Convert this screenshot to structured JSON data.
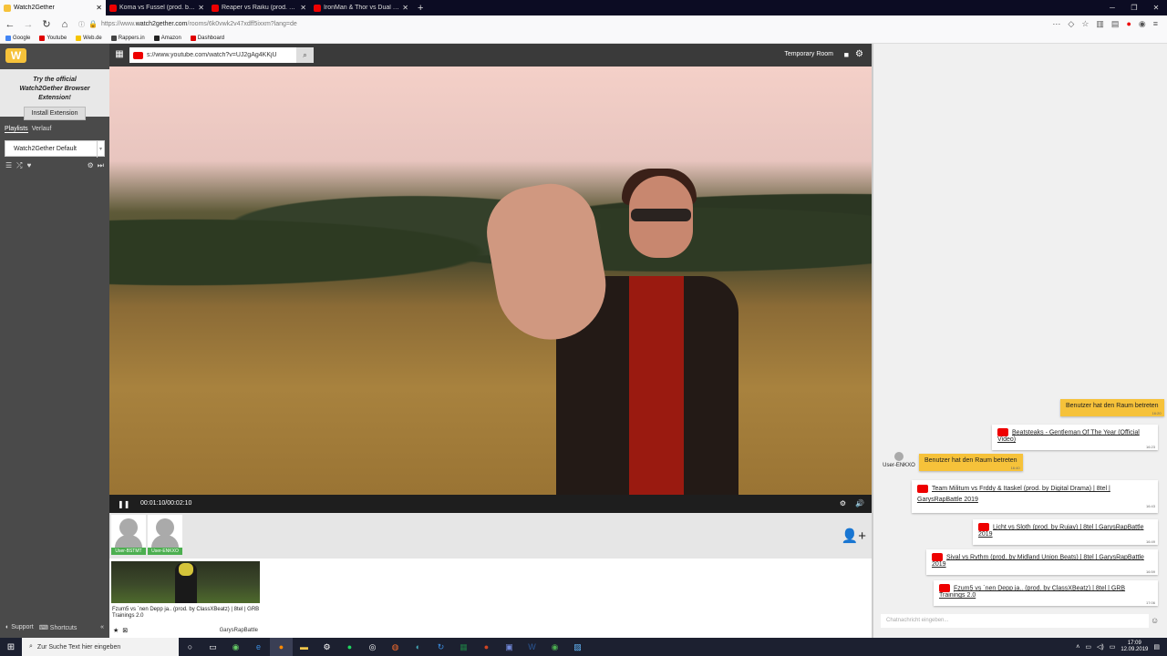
{
  "browser": {
    "tabs": [
      {
        "title": "Watch2Gether",
        "active": true
      },
      {
        "title": "Koma vs Fussel (prod. by ...",
        "active": false
      },
      {
        "title": "Reaper vs Raiku (prod. by ...",
        "active": false
      },
      {
        "title": "IronMan & Thor vs Dual (p...",
        "active": false
      }
    ],
    "url_prefix": "https://www.",
    "url_domain": "watch2gether.com",
    "url_path": "/rooms/6k0vwk2v47xdff5ixxm?lang=de",
    "bookmarks": [
      {
        "label": "Google",
        "color": "#4285f4"
      },
      {
        "label": "Youtube",
        "color": "#e00000"
      },
      {
        "label": "Web.de",
        "color": "#f5c400"
      },
      {
        "label": "Rappers.in",
        "color": "#444444"
      },
      {
        "label": "Amazon",
        "color": "#222222"
      },
      {
        "label": "Dashboard",
        "color": "#e00000"
      }
    ]
  },
  "sidebar": {
    "logo": "W",
    "promo_text": "Try the official Watch2Gether Browser Extension!",
    "install_label": "Install Extension",
    "tab_playlists": "Playlists",
    "tab_history": "Verlauf",
    "playlist_selected": "Watch2Gether Default",
    "support_label": "Support",
    "shortcuts_label": "Shortcuts"
  },
  "room": {
    "url_input": "s://www.youtube.com/watch?v=UJ2gAg4KKjU",
    "title": "Temporary Room"
  },
  "player": {
    "time": "00:01:10/00:02:10"
  },
  "users": [
    {
      "name": "User-BSTMT"
    },
    {
      "name": "User-ENKXO"
    }
  ],
  "playlist_item": {
    "title": "Fzum5 vs `nen Depp ja.. (prod. by ClassXBeatz) | 8tel | GRB Trainings 2.0",
    "channel": "GarysRapBattle"
  },
  "chat": {
    "messages": [
      {
        "type": "sys",
        "text": "Benutzer hat den Raum betreten",
        "time": "16:20"
      },
      {
        "type": "video",
        "text": "Beatsteaks - Gentleman Of The Year (Official Video)",
        "time": "16:23"
      },
      {
        "type": "sys",
        "text": "Benutzer hat den Raum betreten",
        "time": "16:40",
        "user": "User-ENKXO"
      },
      {
        "type": "video",
        "text": "Team Militum vs Frddy & Itaskel (prod. by Digital Drama) | 8tel | GarysRapBattle 2019",
        "time": "16:43"
      },
      {
        "type": "video",
        "text": "Licht vs Sloth (prod. by Rujay) | 8tel | GarysRapBattle 2019",
        "time": "16:49"
      },
      {
        "type": "video",
        "text": "Sival vs Rythm (prod. by Midland Union Beats) | 8tel | GarysRapBattle 2019",
        "time": "16:59"
      },
      {
        "type": "video",
        "text": "Fzum5 vs `nen Depp ja.. (prod. by ClassXBeatz) | 8tel | GRB Trainings 2.0",
        "time": "17:06"
      }
    ],
    "input_placeholder": "Chatnachricht eingeben..."
  },
  "taskbar": {
    "search_placeholder": "Zur Suche Text hier eingeben",
    "time": "17:09",
    "date": "12.09.2019"
  }
}
